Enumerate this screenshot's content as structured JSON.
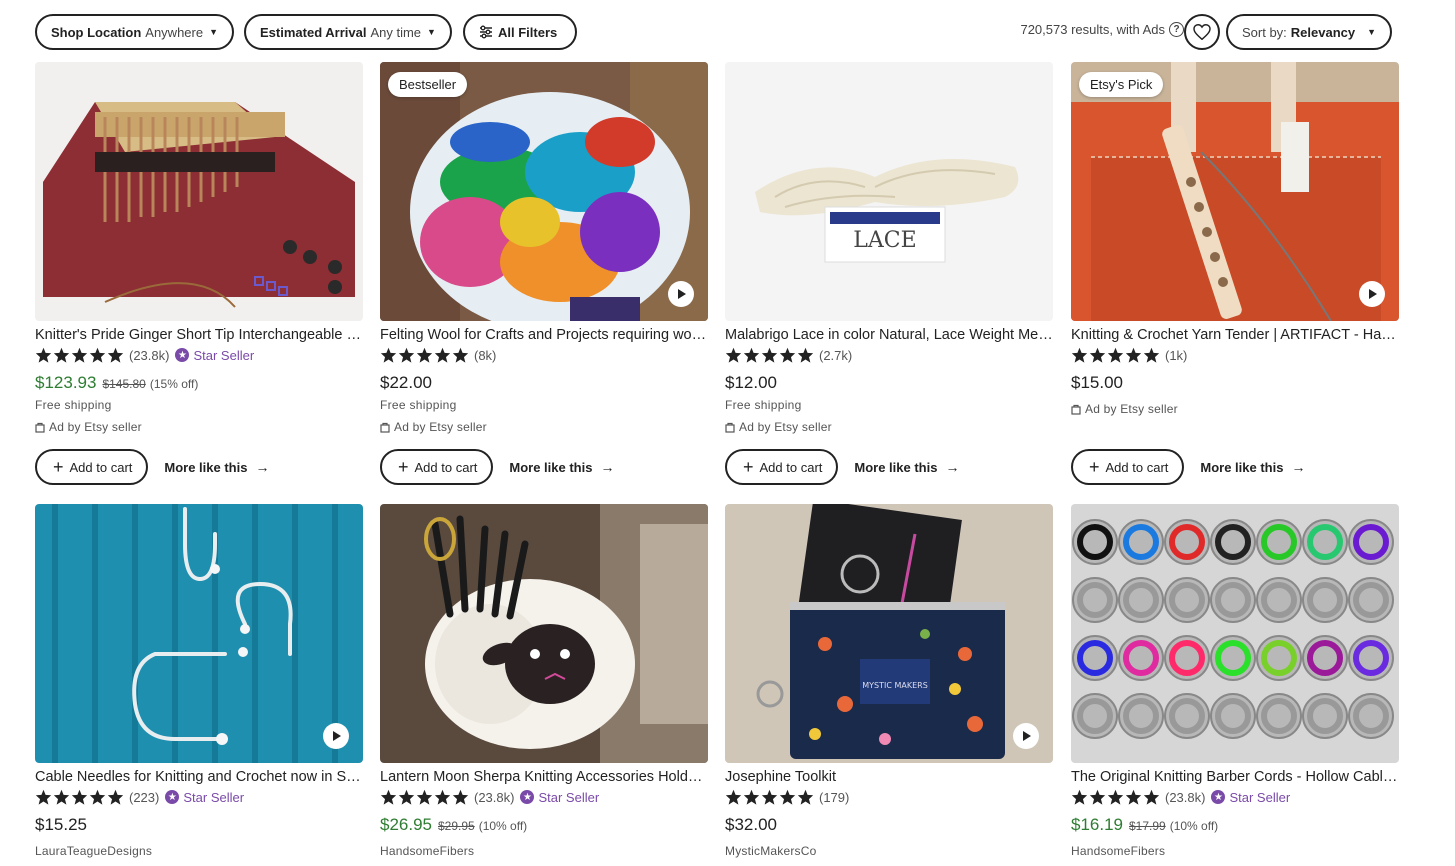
{
  "filters": {
    "shop_location": {
      "label": "Shop Location",
      "value": "Anywhere"
    },
    "estimated_arrival": {
      "label": "Estimated Arrival",
      "value": "Any time"
    },
    "all_filters": "All Filters"
  },
  "results_text": "720,573 results, with Ads",
  "sort": {
    "label": "Sort by:",
    "value": "Relevancy"
  },
  "labels": {
    "add_to_cart": "Add to cart",
    "more_like_this": "More like this",
    "star_seller": "Star Seller",
    "free_shipping": "Free shipping",
    "ad_by": "Ad by Etsy seller"
  },
  "listings": [
    {
      "title": "Knitter's Pride Ginger Short Tip Interchangeable Knitting Needle Set",
      "reviews": "(23.8k)",
      "star_seller": true,
      "price": "$123.93",
      "original_price": "$145.80",
      "discount": "(15% off)",
      "free_shipping": "Free shipping",
      "ad": "Ad by Etsy seller",
      "badge": "",
      "video": false
    },
    {
      "title": "Felting Wool for Crafts and Projects requiring wool roving",
      "reviews": "(8k)",
      "star_seller": false,
      "price": "$22.00",
      "original_price": "",
      "discount": "",
      "free_shipping": "Free shipping",
      "ad": "Ad by Etsy seller",
      "badge": "Bestseller",
      "video": true
    },
    {
      "title": "Malabrigo Lace in color Natural, Lace Weight Merino Wool",
      "reviews": "(2.7k)",
      "star_seller": false,
      "price": "$12.00",
      "original_price": "",
      "discount": "",
      "free_shipping": "Free shipping",
      "ad": "Ad by Etsy seller",
      "badge": "",
      "video": false
    },
    {
      "title": "Knitting & Crochet Yarn Tender | ARTIFACT - Handmade Canvas Tote",
      "reviews": "(1k)",
      "star_seller": false,
      "price": "$15.00",
      "original_price": "",
      "discount": "",
      "free_shipping": "",
      "ad": "Ad by Etsy seller",
      "badge": "Etsy's Pick",
      "video": true
    },
    {
      "title": "Cable Needles for Knitting and Crochet now in Sterling Silver",
      "reviews": "(223)",
      "star_seller": true,
      "price": "$15.25",
      "original_price": "",
      "discount": "",
      "shop": "LauraTeagueDesigns",
      "badge": "",
      "video": true
    },
    {
      "title": "Lantern Moon Sherpa Knitting Accessories Holder Sheep",
      "reviews": "(23.8k)",
      "star_seller": true,
      "price": "$26.95",
      "original_price": "$29.95",
      "discount": "(10% off)",
      "shop": "HandsomeFibers",
      "badge": "",
      "video": false
    },
    {
      "title": "Josephine Toolkit",
      "reviews": "(179)",
      "star_seller": false,
      "price": "$32.00",
      "original_price": "",
      "discount": "",
      "shop": "MysticMakersCo",
      "badge": "",
      "video": true
    },
    {
      "title": "The Original Knitting Barber Cords - Hollow Cable Cords",
      "reviews": "(23.8k)",
      "star_seller": true,
      "price": "$16.19",
      "original_price": "$17.99",
      "discount": "(10% off)",
      "shop": "HandsomeFibers",
      "badge": "",
      "video": false
    }
  ],
  "colors": {
    "sale_green": "#2e7d32",
    "star_seller_purple": "#7a4aa8"
  }
}
